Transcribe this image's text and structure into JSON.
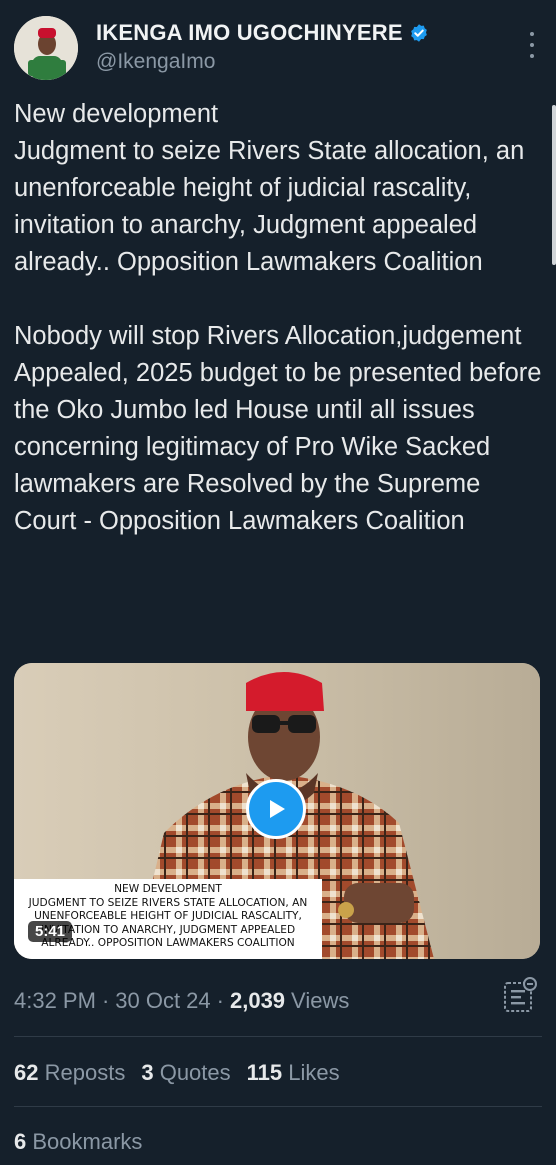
{
  "author": {
    "display_name": "IKENGA IMO UGOCHINYERE",
    "handle": "@IkengaImo",
    "verified": true
  },
  "tweet": {
    "text": "New development\nJudgment to seize Rivers State allocation, an unenforceable height of judicial rascality, invitation to anarchy, Judgment appealed already.. Opposition Lawmakers Coalition\n\nNobody will stop Rivers Allocation,judgement Appealed, 2025 budget to be presented before the Oko Jumbo led House until all issues concerning legitimacy of  Pro Wike Sacked lawmakers are Resolved by the Supreme Court - Opposition Lawmakers Coalition"
  },
  "media": {
    "type": "video",
    "duration": "5:41",
    "caption_lines": [
      "NEW DEVELOPMENT",
      "JUDGMENT TO SEIZE RIVERS STATE ALLOCATION, AN",
      "UNENFORCEABLE HEIGHT OF  JUDICIAL RASCALITY,",
      "INVITATION TO ANARCHY, JUDGMENT APPEALED",
      "ALREADY.. OPPOSITION LAWMAKERS COALITION"
    ]
  },
  "meta": {
    "time": "4:32 PM",
    "separator": "·",
    "date": "30 Oct 24",
    "views_count": "2,039",
    "views_label": "Views"
  },
  "stats": {
    "reposts": {
      "count": "62",
      "label": "Reposts"
    },
    "quotes": {
      "count": "3",
      "label": "Quotes"
    },
    "likes": {
      "count": "115",
      "label": "Likes"
    },
    "bookmarks": {
      "count": "6",
      "label": "Bookmarks"
    }
  },
  "icons": {
    "verified": "verified-badge-icon",
    "more": "more-options-icon",
    "play": "play-icon",
    "analytics": "analytics-icon"
  },
  "colors": {
    "background": "#15202b",
    "accent": "#1d9bf0",
    "secondary_text": "#8b98a5",
    "primary_text": "#e7e9ea"
  }
}
